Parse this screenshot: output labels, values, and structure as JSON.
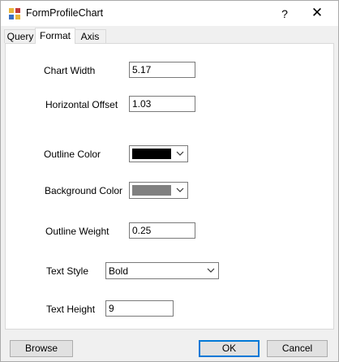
{
  "window": {
    "title": "FormProfileChart",
    "help": "?",
    "close": "✕"
  },
  "tabs": [
    {
      "label": "Query",
      "active": false
    },
    {
      "label": "Format",
      "active": true
    },
    {
      "label": "Axis",
      "active": false
    }
  ],
  "form": {
    "chart_width": {
      "label": "Chart Width",
      "value": "5.17"
    },
    "horizontal_offset": {
      "label": "Horizontal Offset",
      "value": "1.03"
    },
    "outline_color": {
      "label": "Outline Color",
      "color": "#000000"
    },
    "background_color": {
      "label": "Background Color",
      "color": "#808080"
    },
    "outline_weight": {
      "label": "Outline Weight",
      "value": "0.25"
    },
    "text_style": {
      "label": "Text Style",
      "value": "Bold"
    },
    "text_height": {
      "label": "Text Height",
      "value": "9"
    }
  },
  "buttons": {
    "browse": "Browse",
    "ok": "OK",
    "cancel": "Cancel"
  },
  "icons": {
    "app": "chart-app-icon",
    "dropdown": "chevron-down-icon"
  }
}
